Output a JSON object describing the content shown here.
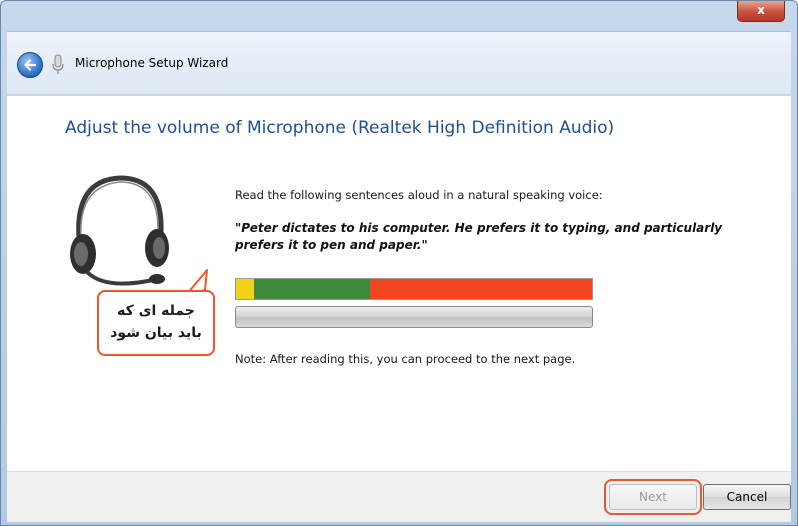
{
  "window": {
    "close_symbol": "x",
    "title": "Microphone Setup Wizard",
    "back_icon": "back-arrow-icon",
    "title_icon": "microphone-icon"
  },
  "main": {
    "heading": "Adjust the volume of Microphone (Realtek High Definition Audio)",
    "instruction": "Read the following sentences aloud in a natural speaking voice:",
    "sentence": "\"Peter dictates to his computer. He prefers it to typing, and particularly prefers it to pen and paper.\"",
    "note": "Note: After reading this, you can proceed to the next page.",
    "illustration": "headset-icon",
    "level_colors": [
      "#f1d317",
      "#3e8a38",
      "#f1461f"
    ],
    "progress": 0
  },
  "callout": {
    "line1": "جمله ای که",
    "line2": "باید بیان شود",
    "border_color": "#e8582f"
  },
  "footer": {
    "next_label": "Next",
    "cancel_label": "Cancel"
  }
}
